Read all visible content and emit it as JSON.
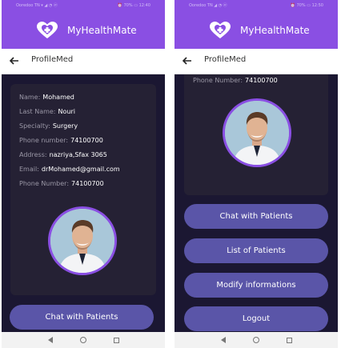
{
  "app": {
    "name": "MyHealthMate",
    "page_title": "ProfileMed"
  },
  "status_bar": {
    "left_text": "Ooredoo TN ▾ ◢ ◔ ⓦ",
    "left_text_2": "Ooredoo TN ◢ ◔ ⓦ",
    "right_text": "⏰ 70% ▭ 12:40",
    "right_text_2": "⏰ 70% ▭ 12:50"
  },
  "doctor": {
    "fields": [
      {
        "key": "Name:",
        "value": "Mohamed"
      },
      {
        "key": "Last Name:",
        "value": "Nouri"
      },
      {
        "key": "Specialty:",
        "value": "Surgery"
      },
      {
        "key": "Phone number:",
        "value": "74100700"
      },
      {
        "key": "Address:",
        "value": "nazriya,Sfax 3065"
      },
      {
        "key": "Email:",
        "value": "drMohamed@gmail.com"
      },
      {
        "key": "Phone Number:",
        "value": "74100700"
      }
    ]
  },
  "buttons": {
    "chat": "Chat with Patients",
    "list": "List of Patients",
    "modify": "Modify informations",
    "logout": "Logout"
  },
  "colors": {
    "header": "#8a4fe3",
    "background": "#1b1732",
    "card": "#252134",
    "button": "#5a55a8"
  }
}
